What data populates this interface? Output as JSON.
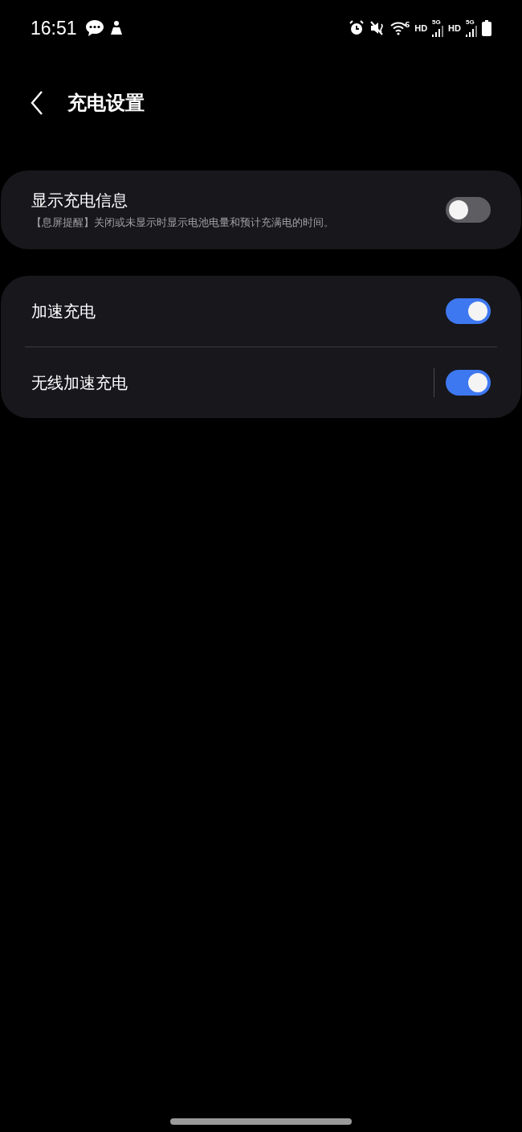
{
  "status_bar": {
    "time": "16:51",
    "wifi_badge": "6",
    "networks": [
      {
        "hd": "HD",
        "gen": "5G"
      },
      {
        "hd": "HD",
        "gen": "5G"
      }
    ]
  },
  "header": {
    "title": "充电设置"
  },
  "groups": [
    {
      "items": [
        {
          "label": "显示充电信息",
          "description": "【息屏提醒】关闭或未显示时显示电池电量和预计充满电的时间。",
          "on": false,
          "separator": false
        }
      ]
    },
    {
      "items": [
        {
          "label": "加速充电",
          "on": true,
          "separator": false
        },
        {
          "label": "无线加速充电",
          "on": true,
          "separator": true
        }
      ]
    }
  ]
}
